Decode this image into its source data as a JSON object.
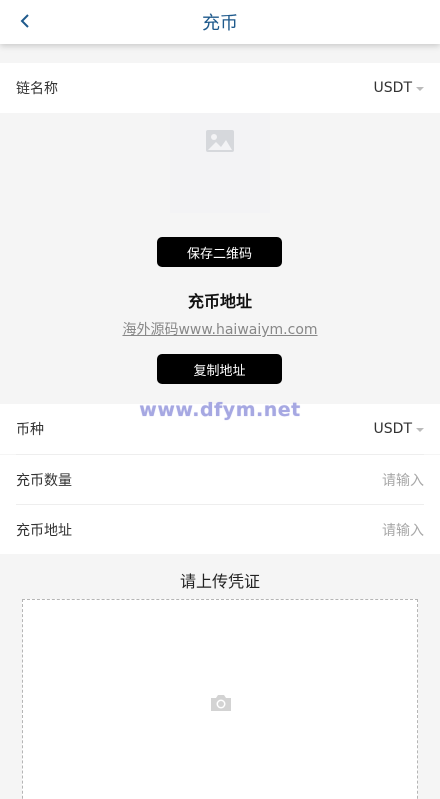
{
  "header": {
    "title": "充币"
  },
  "chain_row": {
    "label": "链名称",
    "value": "USDT"
  },
  "qr": {
    "save_button": "保存二维码",
    "address_title": "充币地址",
    "address_text": "海外源码www.haiwaiym.com",
    "copy_button": "复制地址"
  },
  "watermark": "www.dfym.net",
  "form": {
    "currency": {
      "label": "币种",
      "value": "USDT"
    },
    "amount": {
      "label": "充币数量",
      "placeholder": "请输入"
    },
    "address": {
      "label": "充币地址",
      "placeholder": "请输入"
    }
  },
  "upload": {
    "title": "请上传凭证"
  },
  "colors": {
    "title_blue": "#1f5a8c",
    "button_black": "#000000",
    "watermark": "#a6a8e2"
  },
  "icons": [
    "back-arrow-icon",
    "image-placeholder-icon",
    "caret-down-icon",
    "camera-icon"
  ]
}
